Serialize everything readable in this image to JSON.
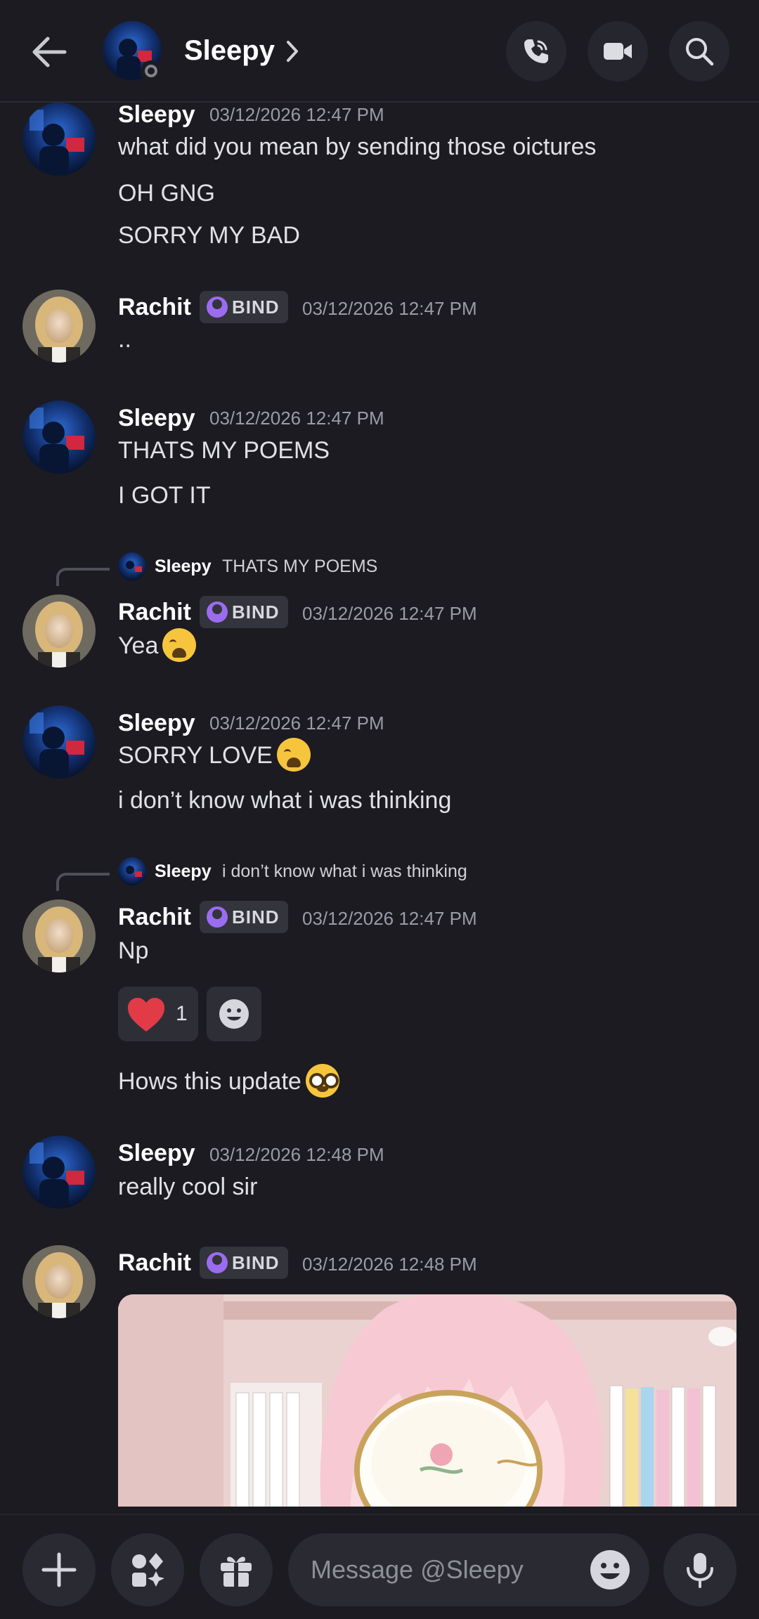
{
  "header": {
    "contact_name": "Sleepy",
    "avatar_icon": "user-avatar",
    "status_color": "#80848e"
  },
  "users": {
    "sleepy": "Sleepy",
    "rachit": "Rachit",
    "rachit_tag": "BIND"
  },
  "messages": [
    {
      "author": "Sleepy",
      "time": "03/12/2026 12:47 PM",
      "lines": [
        "what did you mean by sending those oictures",
        "OH GNG",
        "SORRY MY BAD"
      ]
    },
    {
      "author": "Rachit",
      "time": "03/12/2026 12:47 PM",
      "lines": [
        ".."
      ]
    },
    {
      "author": "Sleepy",
      "time": "03/12/2026 12:47 PM",
      "lines": [
        "THATS MY POEMS",
        "I GOT IT"
      ]
    },
    {
      "author": "Rachit",
      "time": "03/12/2026 12:47 PM",
      "reply": {
        "name": "Sleepy",
        "text": "THATS MY POEMS"
      },
      "lines": [
        "Yea"
      ]
    },
    {
      "author": "Sleepy",
      "time": "03/12/2026 12:47 PM",
      "lines": [
        "SORRY LOVE",
        "i don’t know what i was thinking"
      ]
    },
    {
      "author": "Rachit",
      "time": "03/12/2026 12:47 PM",
      "reply": {
        "name": "Sleepy",
        "text": "i don’t know what i was thinking"
      },
      "lines": [
        "Np",
        "Hows this update"
      ],
      "reaction": {
        "emoji": "heart-icon",
        "count": "1"
      }
    },
    {
      "author": "Sleepy",
      "time": "03/12/2026 12:48 PM",
      "lines": [
        "really cool sir"
      ]
    },
    {
      "author": "Rachit",
      "time": "03/12/2026 12:48 PM",
      "attachment": "anime-image"
    }
  ],
  "composer": {
    "placeholder": "Message @Sleepy"
  },
  "colors": {
    "background": "#1b1b21",
    "accent_purple": "#9b6cf0",
    "heart": "#e23b48"
  }
}
